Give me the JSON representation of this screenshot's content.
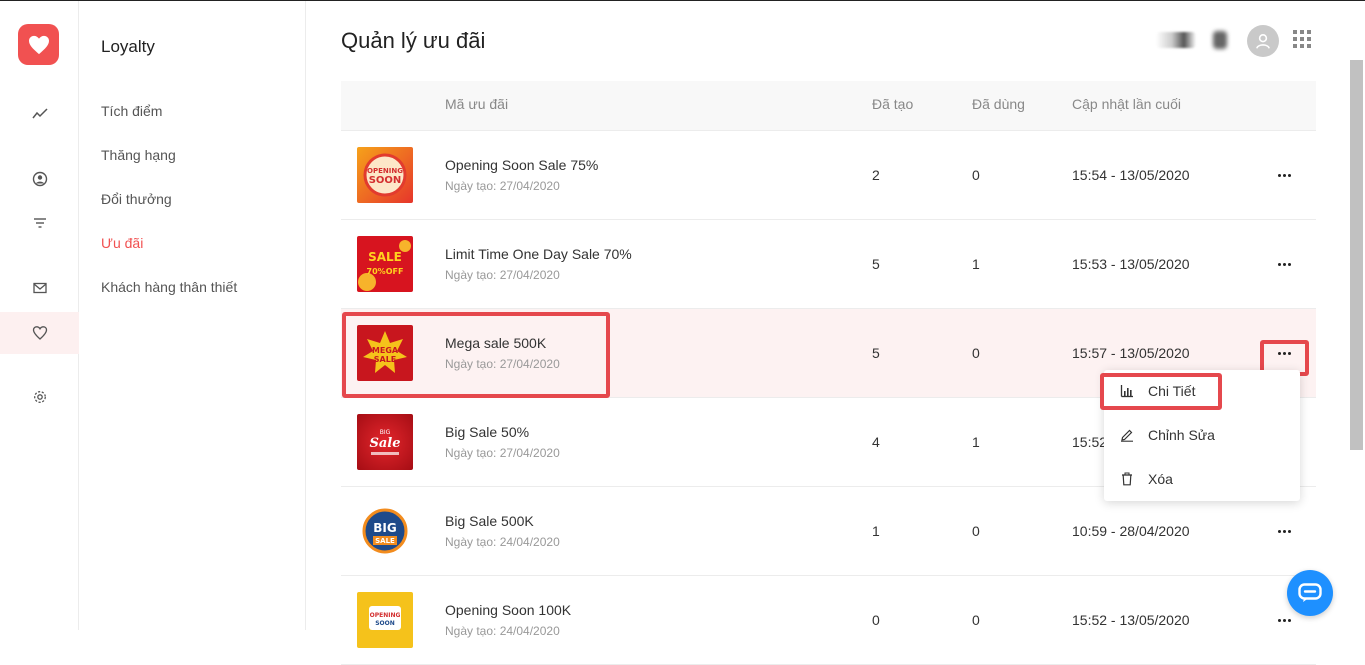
{
  "app": {
    "module_title": "Loyalty",
    "page_title": "Quản lý ưu đãi"
  },
  "sidebar": {
    "items": [
      {
        "label": "Tích điểm",
        "active": false
      },
      {
        "label": "Thăng hạng",
        "active": false
      },
      {
        "label": "Đổi thưởng",
        "active": false
      },
      {
        "label": "Ưu đãi",
        "active": true
      },
      {
        "label": "Khách hàng thân thiết",
        "active": false
      }
    ]
  },
  "table": {
    "headers": {
      "code": "Mã ưu đãi",
      "created": "Đã tạo",
      "used": "Đã dùng",
      "updated": "Cập nhật lần cuối"
    },
    "rows": [
      {
        "name": "Opening Soon Sale 75%",
        "created_date": "Ngày tạo: 27/04/2020",
        "created": "2",
        "used": "0",
        "updated": "15:54 - 13/05/2020"
      },
      {
        "name": "Limit Time One Day Sale 70%",
        "created_date": "Ngày tạo: 27/04/2020",
        "created": "5",
        "used": "1",
        "updated": "15:53 - 13/05/2020"
      },
      {
        "name": "Mega sale 500K",
        "created_date": "Ngày tạo: 27/04/2020",
        "created": "5",
        "used": "0",
        "updated": "15:57 - 13/05/2020"
      },
      {
        "name": "Big Sale 50%",
        "created_date": "Ngày tạo: 27/04/2020",
        "created": "4",
        "used": "1",
        "updated": "15:52"
      },
      {
        "name": "Big Sale 500K",
        "created_date": "Ngày tạo: 24/04/2020",
        "created": "1",
        "used": "0",
        "updated": "10:59 - 28/04/2020"
      },
      {
        "name": "Opening Soon 100K",
        "created_date": "Ngày tạo: 24/04/2020",
        "created": "0",
        "used": "0",
        "updated": "15:52 - 13/05/2020"
      }
    ]
  },
  "thumb_text": {
    "t1": [
      "OPENING",
      "SOON"
    ],
    "t2": [
      "SALE",
      "70%OFF"
    ],
    "t3": [
      "MEGA",
      "SALE"
    ],
    "t4": [
      "BIG",
      "Sale"
    ],
    "t5": [
      "BIG",
      "SALE"
    ],
    "t6": [
      "OPENING",
      "SOON"
    ]
  },
  "context_menu": {
    "items": [
      {
        "label": "Chi Tiết",
        "icon": "bar-chart-icon"
      },
      {
        "label": "Chỉnh Sửa",
        "icon": "pencil-icon"
      },
      {
        "label": "Xóa",
        "icon": "trash-icon"
      }
    ]
  },
  "colors": {
    "accent": "#f15151",
    "highlight_box": "#e5484d",
    "chat": "#1e90ff"
  }
}
